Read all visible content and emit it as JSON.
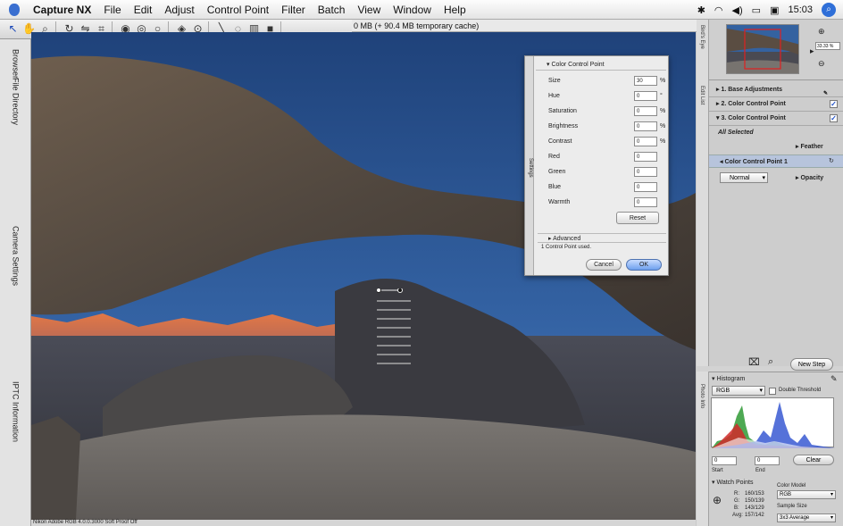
{
  "menubar": {
    "app_name": "Capture NX",
    "items": [
      "File",
      "Edit",
      "Adjust",
      "Control Point",
      "Filter",
      "Batch",
      "View",
      "Window",
      "Help"
    ],
    "clock": "15:03"
  },
  "toolbar": {
    "cache_text": "0 MB (+ 90.4 MB temporary cache)"
  },
  "left_tabs": {
    "browser": "Browser",
    "file_directory": "File Directory",
    "camera_settings": "Camera Settings",
    "iptc": "IPTC Information"
  },
  "status_bar": "Nikon Adobe RGB 4.0.0.3000 Soft Proof Off",
  "dialog": {
    "side_label": "Settings",
    "title": "Color Control Point",
    "params": [
      {
        "label": "Size",
        "value": "30",
        "unit": "%"
      },
      {
        "label": "Hue",
        "value": "0",
        "unit": "°"
      },
      {
        "label": "Saturation",
        "value": "0",
        "unit": "%"
      },
      {
        "label": "Brightness",
        "value": "0",
        "unit": "%"
      },
      {
        "label": "Contrast",
        "value": "0",
        "unit": "%"
      },
      {
        "label": "Red",
        "value": "0",
        "unit": ""
      },
      {
        "label": "Green",
        "value": "0",
        "unit": ""
      },
      {
        "label": "Blue",
        "value": "0",
        "unit": ""
      },
      {
        "label": "Warmth",
        "value": "0",
        "unit": ""
      }
    ],
    "reset": "Reset",
    "advanced": "Advanced",
    "used": "1 Control Point used.",
    "cancel": "Cancel",
    "ok": "OK"
  },
  "right_panel": {
    "birdseye_label": "Bird's Eye",
    "zoom": "33.33 %",
    "edit_list_label": "Edit List",
    "steps": [
      {
        "label": "1. Base Adjustments",
        "checked": false
      },
      {
        "label": "2. Color Control Point",
        "checked": true
      },
      {
        "label": "3. Color Control Point",
        "checked": true
      }
    ],
    "all_selected": "All Selected",
    "feather": "Feather",
    "ccp1": "Color Control Point 1",
    "blend_mode": "Normal",
    "opacity": "Opacity",
    "new_step": "New Step",
    "photo_info_label": "Photo Info",
    "histogram_title": "Histogram",
    "histogram_channel": "RGB",
    "double_threshold": "Double Threshold",
    "start_value": "0",
    "end_value": "0",
    "start_label": "Start",
    "end_label": "End",
    "clear": "Clear",
    "watch_points": "Watch Points",
    "color_model_label": "Color Model",
    "color_model": "RGB",
    "sample_size_label": "Sample Size",
    "sample_size": "3x3 Average",
    "readouts": {
      "r_label": "R:",
      "r": "160/153",
      "g_label": "G:",
      "g": "150/139",
      "b_label": "B:",
      "b": "143/129",
      "avg_label": "Avg:",
      "avg": "157/142"
    }
  },
  "colors": {
    "sky": "#2b5591",
    "rock": "#5a5149",
    "mountains": "#c8663a",
    "accent": "#2f6fd8"
  }
}
